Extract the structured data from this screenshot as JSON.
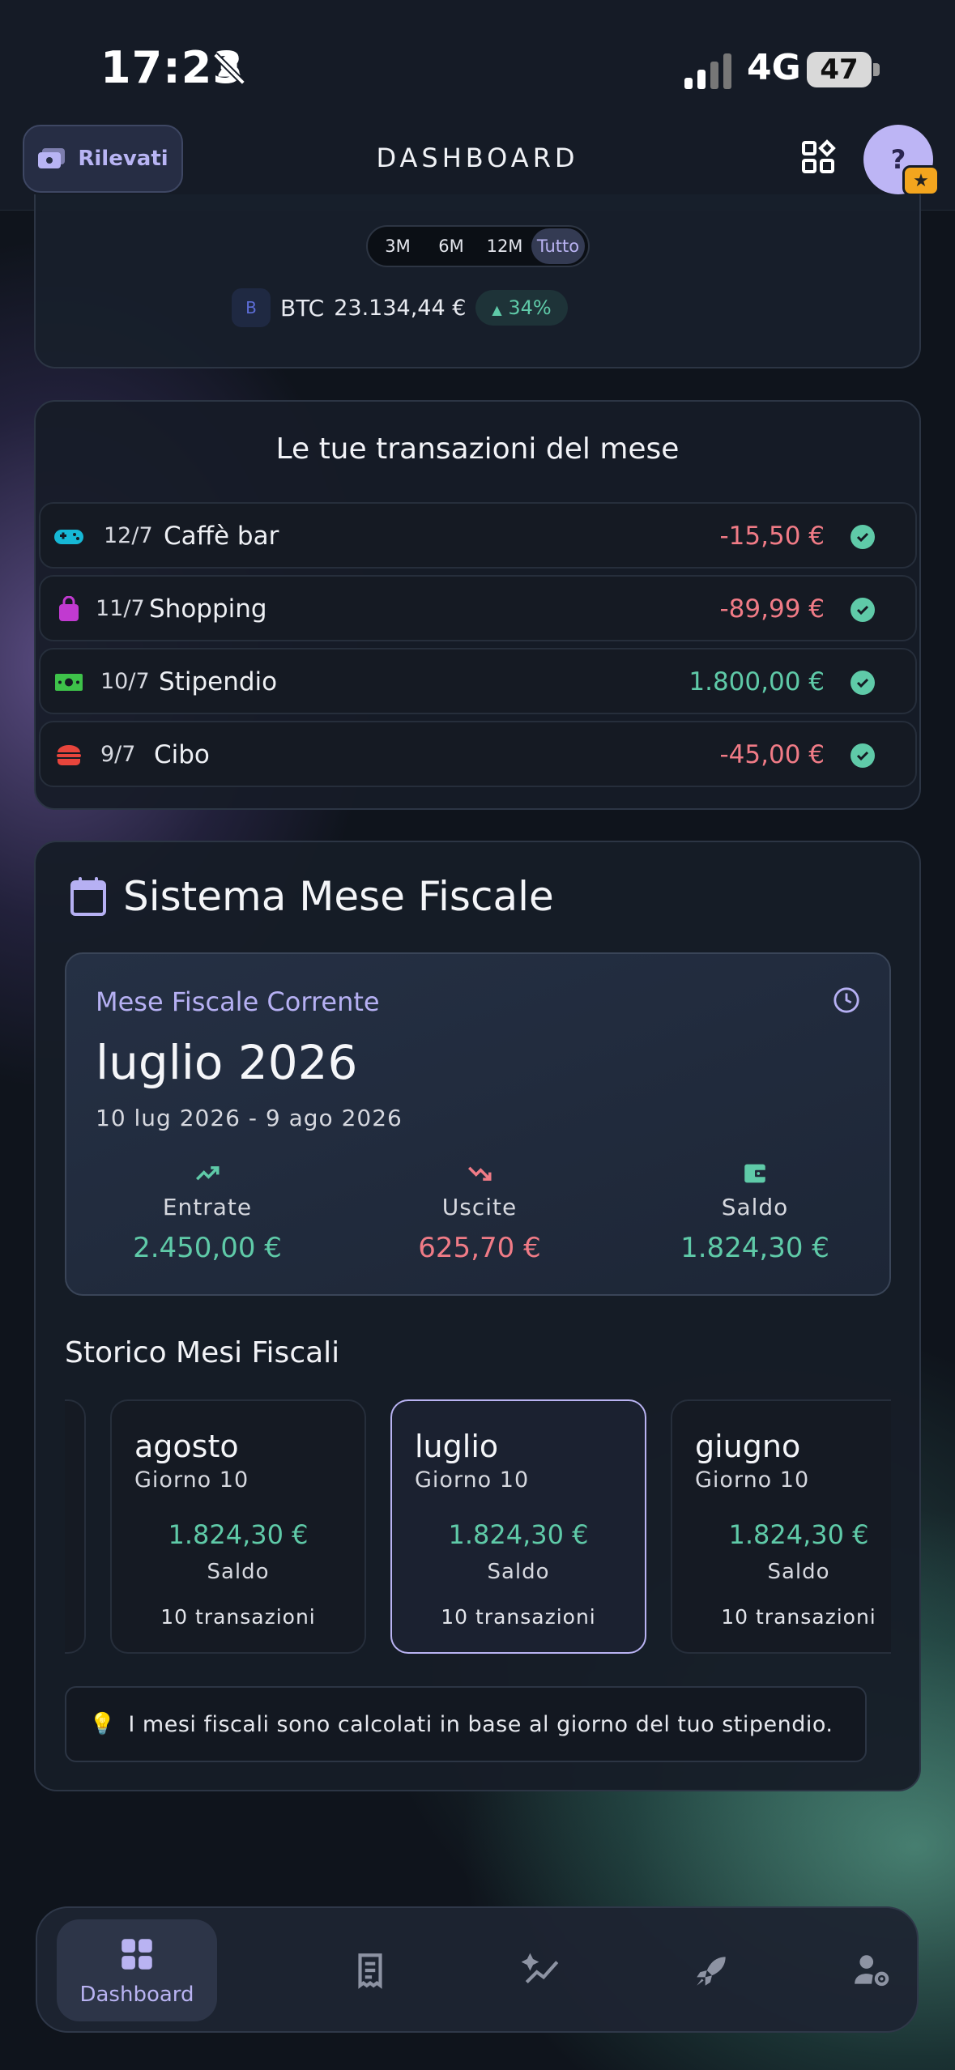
{
  "status_bar": {
    "time": "17:23",
    "network": "4G",
    "battery": "47"
  },
  "header": {
    "source_button": "Rilevati",
    "title": "DASHBOARD",
    "avatar": "?"
  },
  "chart_tail": {
    "ranges": [
      "3M",
      "6M",
      "12M",
      "Tutto"
    ],
    "active_range": "Tutto",
    "asset": {
      "icon_letter": "B",
      "symbol": "BTC",
      "value": "23.134,44 €",
      "change": "34%"
    }
  },
  "transactions": {
    "title": "Le tue transazioni del mese",
    "items": [
      {
        "icon": "gamepad-icon",
        "date": "12/7",
        "name": "Caffè bar",
        "amount": "-15,50 €",
        "type": "expense"
      },
      {
        "icon": "shopping-bag-icon",
        "date": "11/7",
        "name": "Shopping",
        "amount": "-89,99 €",
        "type": "expense"
      },
      {
        "icon": "money-icon",
        "date": "10/7",
        "name": "Stipendio",
        "amount": "1.800,00 €",
        "type": "income"
      },
      {
        "icon": "burger-icon",
        "date": "9/7",
        "name": "Cibo",
        "amount": "-45,00 €",
        "type": "expense"
      }
    ]
  },
  "fiscal": {
    "title": "Sistema Mese Fiscale",
    "current": {
      "label": "Mese Fiscale Corrente",
      "month": "luglio 2026",
      "range": "10 lug 2026 - 9 ago 2026",
      "stats": [
        {
          "label": "Entrate",
          "value": "2.450,00 €",
          "color": "#5fcaa8"
        },
        {
          "label": "Uscite",
          "value": "625,70 €",
          "color": "#f07b86"
        },
        {
          "label": "Saldo",
          "value": "1.824,30 €",
          "color": "#5fcaa8"
        }
      ]
    },
    "history_title": "Storico Mesi Fiscali",
    "history": [
      {
        "month": "agosto",
        "day": "Giorno 10",
        "amount": "1.824,30 €",
        "amount_label": "Saldo",
        "transactions": "10 transazioni"
      },
      {
        "month": "luglio",
        "day": "Giorno 10",
        "amount": "1.824,30 €",
        "amount_label": "Saldo",
        "transactions": "10 transazioni"
      },
      {
        "month": "giugno",
        "day": "Giorno 10",
        "amount": "1.824,30 €",
        "amount_label": "Saldo",
        "transactions": "10 transazioni"
      }
    ],
    "tip": "I mesi fiscali sono calcolati in base al giorno del tuo stipendio."
  },
  "nav": {
    "items": [
      "Dashboard"
    ],
    "active": "Dashboard"
  },
  "colors": {
    "accent": "#b9b3f2",
    "income": "#5fcaa8",
    "expense": "#f07b86"
  }
}
